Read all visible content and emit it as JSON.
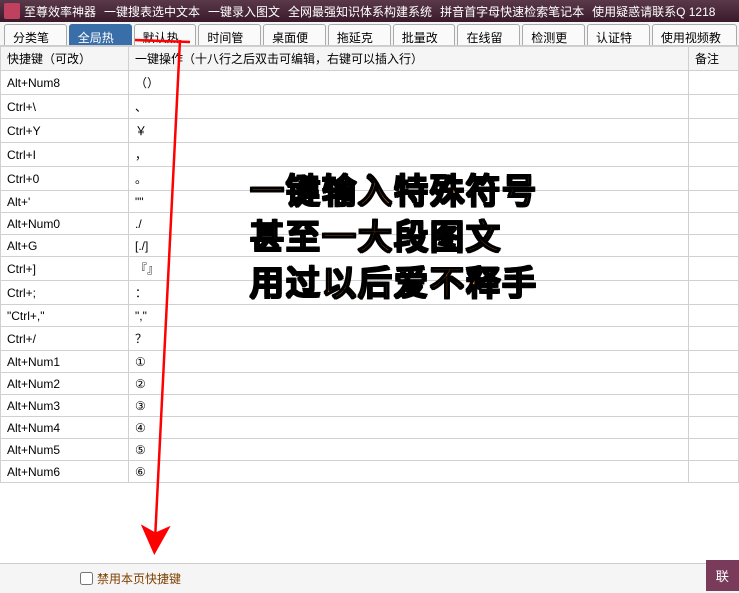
{
  "menubar": {
    "app_title": "至尊效率神器",
    "items": [
      "一键搜表选中文本",
      "一键录入图文",
      "全网最强知识体系构建系统",
      "拼音首字母快速检索笔记本",
      "使用疑惑请联系Q 1218"
    ]
  },
  "tabs": [
    "分类笔记",
    "全局热键",
    "默认热键",
    "时间管理",
    "桌面便笺",
    "拖延克星",
    "批量改名",
    "在线留言",
    "检测更新",
    "认证特权",
    "使用视频教程"
  ],
  "active_tab_index": 1,
  "columns": {
    "hotkey": "快捷键（可改）",
    "action": "一键操作（十八行之后双击可编辑，右键可以插入行）",
    "remark": "备注"
  },
  "rows": [
    {
      "hotkey": "Alt+Num8",
      "action": "（）"
    },
    {
      "hotkey": "Ctrl+\\",
      "action": "、"
    },
    {
      "hotkey": "Ctrl+Y",
      "action": "￥"
    },
    {
      "hotkey": "Ctrl+I",
      "action": "，"
    },
    {
      "hotkey": "Ctrl+0",
      "action": "。"
    },
    {
      "hotkey": "Alt+'",
      "action": "\"\""
    },
    {
      "hotkey": "Alt+Num0",
      "action": "./"
    },
    {
      "hotkey": "Alt+G",
      "action": "[./]"
    },
    {
      "hotkey": "Ctrl+]",
      "action": "『』"
    },
    {
      "hotkey": "Ctrl+;",
      "action": "："
    },
    {
      "hotkey": "\"Ctrl+,\"",
      "action": "\",\""
    },
    {
      "hotkey": "Ctrl+/",
      "action": "？"
    },
    {
      "hotkey": "Alt+Num1",
      "action": "①"
    },
    {
      "hotkey": "Alt+Num2",
      "action": "②"
    },
    {
      "hotkey": "Alt+Num3",
      "action": "③"
    },
    {
      "hotkey": "Alt+Num4",
      "action": "④"
    },
    {
      "hotkey": "Alt+Num5",
      "action": "⑤"
    },
    {
      "hotkey": "Alt+Num6",
      "action": "⑥"
    }
  ],
  "bottom": {
    "checkbox_label": "禁用本页快捷键",
    "button_label": "联"
  },
  "overlay": {
    "line1": "一键输入特殊符号",
    "line2": "甚至一大段图文",
    "line3": "用过以后爱不释手"
  },
  "colors": {
    "menubar_bg": "#3a1a2a",
    "active_tab": "#3a6ea8",
    "overlay_fill": "#ff8c1a",
    "arrow": "#ff0000"
  }
}
